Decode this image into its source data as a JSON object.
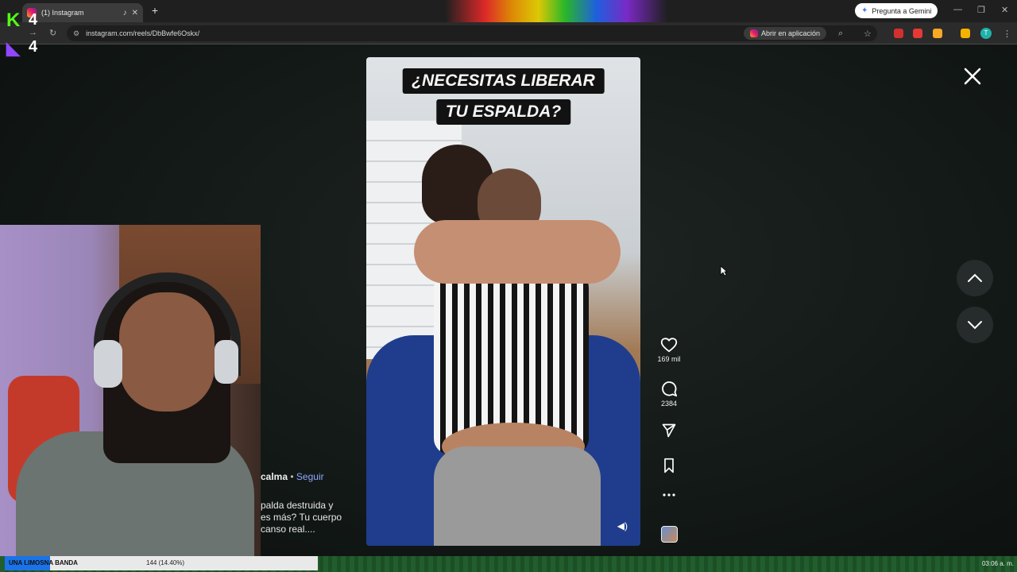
{
  "browser": {
    "tab_title": "(1) Instagram",
    "url": "instagram.com/reels/DbBwfe6Oskx/",
    "gemini_label": "Pregunta a Gemini",
    "open_app_label": "Abrir en aplicación",
    "profile_initial": "T"
  },
  "overlay": {
    "logo_top_number": "4",
    "logo_bottom_number": "4"
  },
  "reel": {
    "caption_line1": "¿NECESITAS LIBERAR",
    "caption_line2": "TU ESPALDA?",
    "likes": "169 mil",
    "comments": "2384",
    "author": "calma",
    "follow_label": "Seguir",
    "description_lines": [
      "palda destruida y",
      "es más? Tu cuerpo",
      "canso real...."
    ]
  },
  "progress": {
    "label": "UNA LIMOSNA BANDA",
    "value_text": "144 (14.40%)",
    "fraction": 0.144
  },
  "clock": "03:06 a. m.",
  "colors": {
    "background": "#121816",
    "link_blue": "#8fa8ff",
    "progress_fill": "#1a73e8",
    "bottom_bar": "#1f5a2a"
  }
}
